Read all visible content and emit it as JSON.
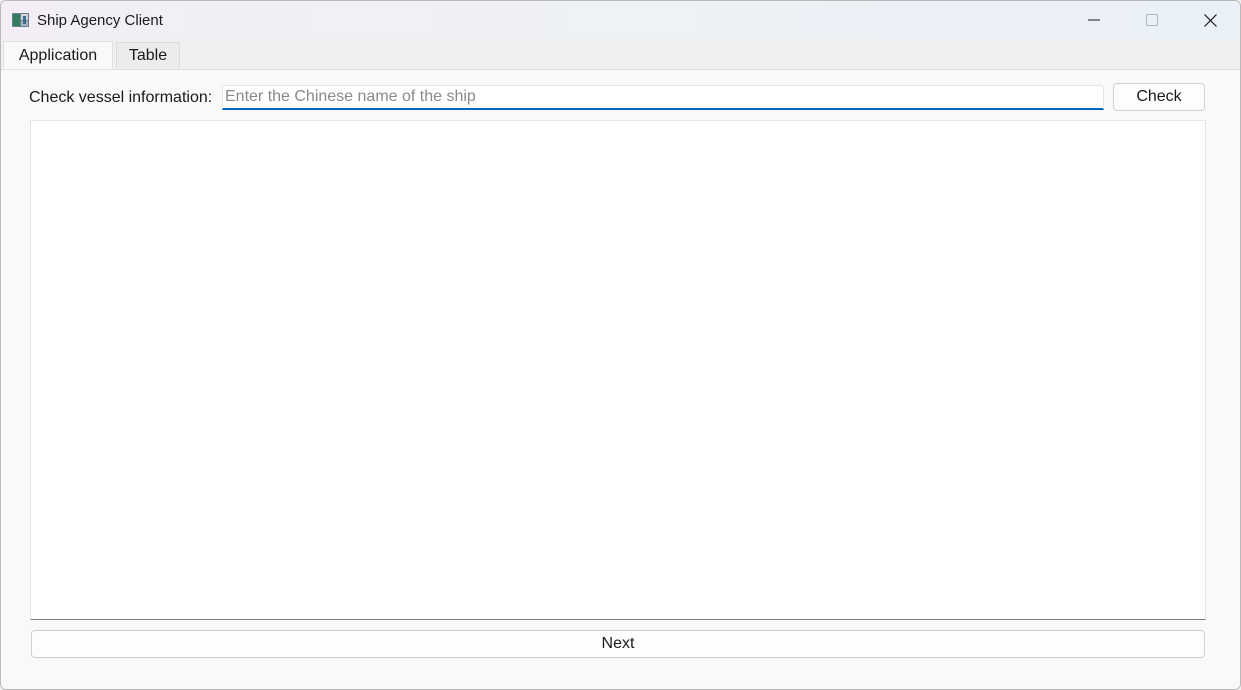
{
  "window": {
    "title": "Ship Agency Client",
    "app_icon": "ship-agency-app-icon",
    "controls": {
      "minimize_icon": "minimize-icon",
      "maximize_icon": "maximize-icon",
      "close_icon": "close-icon"
    }
  },
  "tabs": [
    {
      "label": "Application",
      "active": true
    },
    {
      "label": "Table",
      "active": false
    }
  ],
  "search": {
    "label": "Check vessel information:",
    "value": "",
    "placeholder": "Enter the Chinese name of the ship",
    "button_label": "Check"
  },
  "results": {
    "content": ""
  },
  "footer": {
    "next_label": "Next"
  },
  "colors": {
    "accent": "#0067c0",
    "window_bg": "#f9f9f9",
    "panel_bg": "#ffffff"
  }
}
